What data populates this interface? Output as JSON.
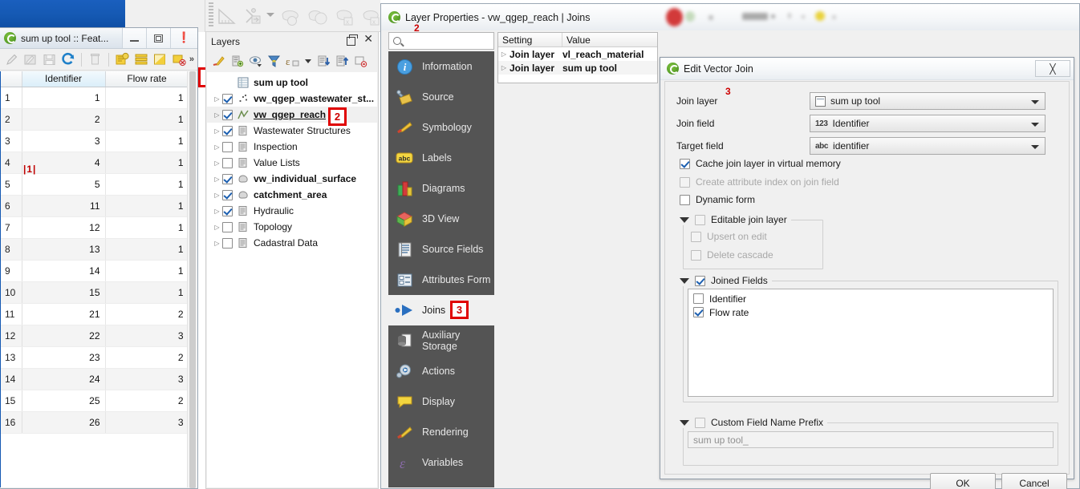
{
  "attribute_table": {
    "title": "sum up tool :: Feat...",
    "window_buttons": [
      "minimize",
      "maximize",
      "close"
    ],
    "toolbar_icons": [
      "toggle-editing-pencil",
      "save-edits",
      "save-layer-edits",
      "reload-refresh",
      "delete-selected",
      "new-field",
      "select-all",
      "invert-selection",
      "deselect-all",
      "more-chevron"
    ],
    "columns": [
      "",
      "Identifier",
      "Flow rate"
    ],
    "editing_cell_text": "1",
    "rows": [
      {
        "index": "1",
        "identifier": "1",
        "flow_rate": "1"
      },
      {
        "index": "2",
        "identifier": "2",
        "flow_rate": "1"
      },
      {
        "index": "3",
        "identifier": "3",
        "flow_rate": "1"
      },
      {
        "index": "4",
        "identifier": "4",
        "flow_rate": "1"
      },
      {
        "index": "5",
        "identifier": "5",
        "flow_rate": "1"
      },
      {
        "index": "6",
        "identifier": "11",
        "flow_rate": "1"
      },
      {
        "index": "7",
        "identifier": "12",
        "flow_rate": "1"
      },
      {
        "index": "8",
        "identifier": "13",
        "flow_rate": "1"
      },
      {
        "index": "9",
        "identifier": "14",
        "flow_rate": "1"
      },
      {
        "index": "10",
        "identifier": "15",
        "flow_rate": "1"
      },
      {
        "index": "11",
        "identifier": "21",
        "flow_rate": "2"
      },
      {
        "index": "12",
        "identifier": "22",
        "flow_rate": "3"
      },
      {
        "index": "13",
        "identifier": "23",
        "flow_rate": "2"
      },
      {
        "index": "14",
        "identifier": "24",
        "flow_rate": "3"
      },
      {
        "index": "15",
        "identifier": "25",
        "flow_rate": "2"
      },
      {
        "index": "16",
        "identifier": "26",
        "flow_rate": "3"
      }
    ]
  },
  "layers_panel": {
    "title": "Layers",
    "header_buttons": [
      "float-panel-icon",
      "close-icon"
    ],
    "toolbar_icons": [
      "open-layer-styling-icon",
      "add-group-icon",
      "manage-visibility-icon",
      "filter-legend-icon",
      "expression-filter-icon",
      "expand-all-icon",
      "collapse-all-icon",
      "remove-layer-icon"
    ],
    "items": [
      {
        "label": "sum up tool",
        "checked": null,
        "bold": true,
        "icon": "table-icon",
        "expandable": false,
        "selected": false
      },
      {
        "label": "vw_qgep_wastewater_st...",
        "checked": true,
        "bold": true,
        "icon": "point-layer-icon",
        "expandable": true,
        "selected": false
      },
      {
        "label": "vw_qgep_reach",
        "checked": true,
        "bold": true,
        "icon": "line-layer-icon",
        "expandable": true,
        "selected": true
      },
      {
        "label": "Wastewater Structures",
        "checked": true,
        "bold": false,
        "icon": "group-icon",
        "expandable": true,
        "selected": false
      },
      {
        "label": "Inspection",
        "checked": false,
        "bold": false,
        "icon": "group-icon",
        "expandable": true,
        "selected": false
      },
      {
        "label": "Value Lists",
        "checked": false,
        "bold": false,
        "icon": "group-icon",
        "expandable": true,
        "selected": false
      },
      {
        "label": "vw_individual_surface",
        "checked": true,
        "bold": true,
        "icon": "polygon-layer-icon",
        "expandable": true,
        "selected": false
      },
      {
        "label": "catchment_area",
        "checked": true,
        "bold": true,
        "icon": "polygon-layer-icon",
        "expandable": true,
        "selected": false
      },
      {
        "label": "Hydraulic",
        "checked": true,
        "bold": false,
        "icon": "group-icon",
        "expandable": true,
        "selected": false
      },
      {
        "label": "Topology",
        "checked": false,
        "bold": false,
        "icon": "group-icon",
        "expandable": true,
        "selected": false
      },
      {
        "label": "Cadastral Data",
        "checked": false,
        "bold": false,
        "icon": "group-icon",
        "expandable": true,
        "selected": false
      }
    ]
  },
  "layer_properties": {
    "title": "Layer Properties - vw_qgep_reach | Joins",
    "search_placeholder": "",
    "nav_items": [
      {
        "label": "Information",
        "icon": "information-icon",
        "active": false
      },
      {
        "label": "Source",
        "icon": "source-wrench-icon",
        "active": false
      },
      {
        "label": "Symbology",
        "icon": "symbology-brush-icon",
        "active": false
      },
      {
        "label": "Labels",
        "icon": "labels-abc-icon",
        "active": false
      },
      {
        "label": "Diagrams",
        "icon": "diagrams-chart-icon",
        "active": false
      },
      {
        "label": "3D View",
        "icon": "3d-view-cube-icon",
        "active": false
      },
      {
        "label": "Source Fields",
        "icon": "source-fields-icon",
        "active": false
      },
      {
        "label": "Attributes Form",
        "icon": "attributes-form-icon",
        "active": false
      },
      {
        "label": "Joins",
        "icon": "joins-icon",
        "active": true
      },
      {
        "label": "Auxiliary Storage",
        "icon": "auxiliary-storage-icon",
        "active": false
      },
      {
        "label": "Actions",
        "icon": "actions-gear-icon",
        "active": false
      },
      {
        "label": "Display",
        "icon": "display-balloon-icon",
        "active": false
      },
      {
        "label": "Rendering",
        "icon": "rendering-brush-icon",
        "active": false
      },
      {
        "label": "Variables",
        "icon": "variables-icon",
        "active": false
      }
    ],
    "joins_table": {
      "columns": [
        "Setting",
        "Value"
      ],
      "rows": [
        {
          "setting": "Join layer",
          "value": "vl_reach_material"
        },
        {
          "setting": "Join layer",
          "value": "sum up tool"
        }
      ]
    }
  },
  "edit_vector_join": {
    "title": "Edit Vector Join",
    "close_label": "╳",
    "fields": [
      {
        "label": "Join layer",
        "value": "sum up tool",
        "chip": "table"
      },
      {
        "label": "Join field",
        "value": "Identifier",
        "chip": "123"
      },
      {
        "label": "Target field",
        "value": "identifier",
        "chip": "abc"
      }
    ],
    "checkboxes": [
      {
        "label": "Cache join layer in virtual memory",
        "checked": true,
        "disabled": false
      },
      {
        "label": "Create attribute index on join field",
        "checked": false,
        "disabled": true
      },
      {
        "label": "Dynamic form",
        "checked": false,
        "disabled": false
      }
    ],
    "editable_join_layer": {
      "label": "Editable join layer",
      "checked": false,
      "children": [
        {
          "label": "Upsert on edit",
          "checked": false,
          "disabled": true
        },
        {
          "label": "Delete cascade",
          "checked": false,
          "disabled": true
        }
      ]
    },
    "joined_fields": {
      "label": "Joined Fields",
      "checked": true,
      "fields": [
        {
          "label": "Identifier",
          "checked": false
        },
        {
          "label": "Flow rate",
          "checked": true
        }
      ]
    },
    "custom_prefix": {
      "label": "Custom Field Name Prefix",
      "checked": false,
      "value": "sum up tool_"
    },
    "buttons": {
      "ok": "OK",
      "cancel": "Cancel"
    }
  },
  "annotations": [
    {
      "id": "1",
      "target": "attribute-table-window"
    },
    {
      "id": "2",
      "target": "vw_qgep_reach-layer"
    },
    {
      "id": "2",
      "target": "layer-properties-title"
    },
    {
      "id": "3",
      "target": "joins-nav-item"
    },
    {
      "id": "3",
      "target": "join-layer-field"
    }
  ],
  "colors": {
    "annotation_red": "#e00000",
    "annotation_text": "#cc0000",
    "nav_dark": "#545454",
    "selection_blue": "#1c5fb0",
    "titlebar_blue": "#1559b3"
  }
}
